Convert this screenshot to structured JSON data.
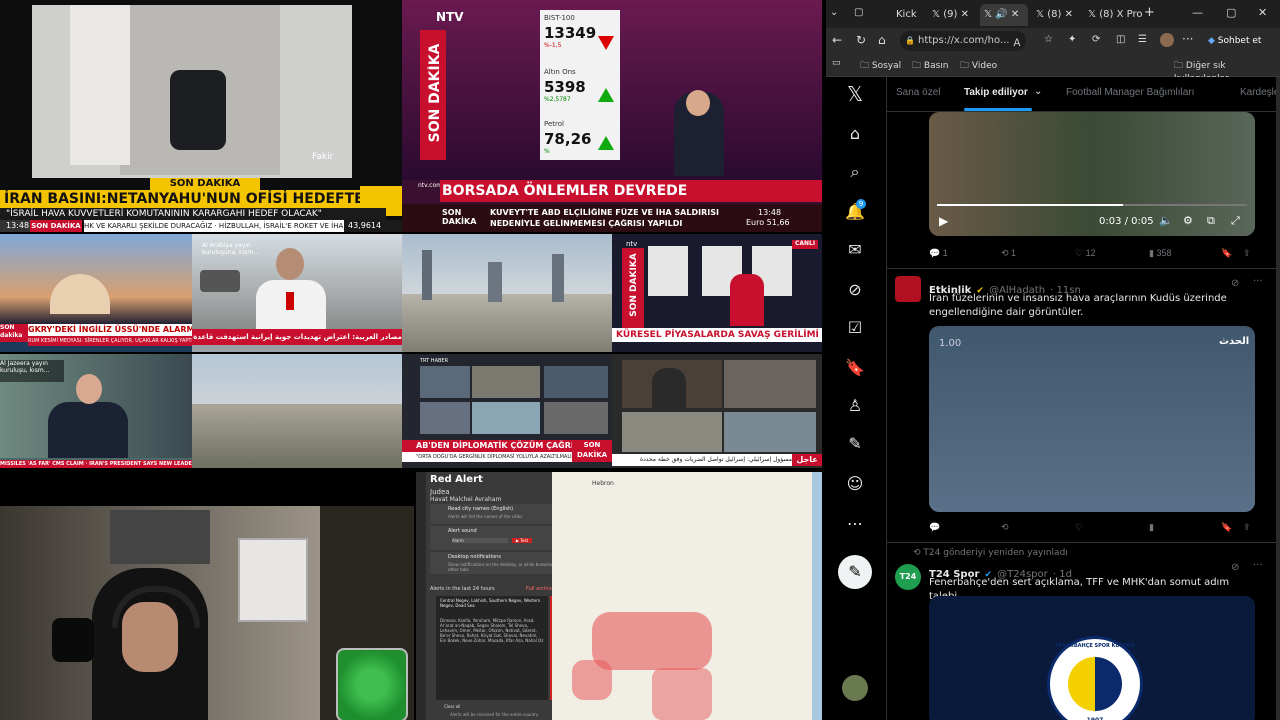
{
  "tv": {
    "top_center": {
      "logo": "NTV",
      "side_label": "SON DAKİKA",
      "board": [
        {
          "name": "BIST-100",
          "value": "13349",
          "change": "%-1,5"
        },
        {
          "name": "Altın Ons",
          "value": "5398",
          "change": "%2,5787"
        },
        {
          "name": "Petrol",
          "value": "78,26",
          "change": "%"
        }
      ],
      "headline": "BORSADA ÖNLEMLER DEVREDE",
      "sub_label": "SON DAKİKA",
      "sub_text_1": "KUVEYT'TE ABD ELÇİLİĞİNE FÜZE VE İHA SALDIRISI",
      "sub_text_2": "NEDENİYLE GELİNMEMESİ ÇAĞRISI YAPILDI",
      "time": "13:48",
      "euro": "Euro   51,66",
      "site": "ntv.com.tr"
    },
    "top_left": {
      "watermark": "Fakir",
      "tag": "SON DAKİKA",
      "headline": "İRAN BASINI:NETANYAHU'NUN OFİSİ HEDEFTE",
      "sub": "\"İSRAİL HAVA KUVVETLERİ KOMUTANININ KARARGAHI HEDEF OLACAK\"",
      "time": "13:48",
      "ticker_label": "SON DAKİKA",
      "ticker": "HK VE KARARLI ŞEKİLDE DURACAĞIZ  ·  HİZBULLAH, İSRAİL'E ROKET VE İHA",
      "value": "43,9614"
    },
    "mid_1": {
      "label": "SON dakika",
      "headline": "GKRY'DEKİ İNGİLİZ ÜSSÜ'NDE ALARM",
      "sub": "RUM KESİMİ MEDYASI: SİRENLER ÇALIYOR, UÇAKLAR KALKIŞ YAPTI"
    },
    "mid_2": {
      "caption": "Al Arabiya yayın kuruluşuna, kısm...",
      "bar": "مصادر العربية: اعتراض تهديدات جوية إيرانية استهدفت قاعدة قرب الرياض"
    },
    "mid_4": {
      "logo": "ntv",
      "tag": "SON DAKİKA",
      "headline": "KÜRESEL PİYASALARDA SAVAŞ GERİLİMİ",
      "live": "CANLI"
    },
    "row3_1": {
      "caption": "Al Jazeera yayın kuruluşu, kısm...",
      "ticker": "MISSILES 'AS FAR' CMS CLAIM  ·  IRAN'S PRESIDENT SAYS NEW LEADERSHIP COUNCIL"
    },
    "row3_3": {
      "network": "TRT HABER",
      "headline": "AB'DEN DİPLOMATİK ÇÖZÜM ÇAĞRISI",
      "sub": "\"ORTA DOĞU'DA GERGİNLİK DİPLOMASİ YOLUYLA AZALTILMALI\"",
      "tag": "SON DAKİKA"
    },
    "row3_4": {
      "urgent": "عاجل",
      "ticker": "مسؤول إسرائيلي: إسرائيل تواصل الضربات وفق خطة محددة"
    }
  },
  "redalert": {
    "title": "Red Alert",
    "region": "Judea",
    "city": "Havat Malchei Avraham",
    "opt1_title": "Read city names (English)",
    "opt1_desc": "Alerts will tell the names of the cities",
    "opt2_title": "Alert sound",
    "opt2_value": "Alarm",
    "opt2_btn": "▶ Test",
    "opt3_title": "Desktop notifications",
    "opt3_desc": "Show notifications on the desktop, or while browsing other tabs",
    "alerts_header": "Alerts in the last 24 hours",
    "full_archive": "Full archive",
    "alert_regions": "Central Negev, Lakhish, Southern Negev, Western Negev, Dead Sea",
    "alert_list": "Dimona, Kseifa, Yeruham, Mitzpe Ramon, Arad, Ar'arat an-Naqab, Segev Shalom, Tel Sheva, Lehavim, Omer, Meitar, Ofakim, Netivot, Sderot, Be'er Sheva, Rahat, Kiryat Gat, Shoval, Nevatim, Ein Bokek, Neve Zohar, Masada, Kfar Aza, Nahal Oz",
    "clear_all": "Clear all",
    "footer": "Alerts will be received for the entire country",
    "map_label": "Hebron"
  },
  "browser": {
    "tabs": [
      {
        "label": "Kick"
      },
      {
        "label": "(9)"
      },
      {
        "label": ""
      },
      {
        "label": "(8)"
      },
      {
        "label": "(8) X Pro"
      }
    ],
    "new_tab": "+",
    "url": "https://x.com/ho...",
    "chat_btn": "Sohbet et",
    "bookmarks": [
      "Sosyal",
      "Basın",
      "Video"
    ],
    "other_bookmarks": "Diğer sık kullanılanlar"
  },
  "x": {
    "tabs": [
      "Sana özel",
      "Takip ediliyor",
      "Football Manager Bağımlıları",
      "Kardeşle"
    ],
    "notif_count": "9",
    "post1": {
      "time": "0:03 / 0:05",
      "replies": "1",
      "reposts": "1",
      "likes": "12",
      "views": "358"
    },
    "post2": {
      "name": "Etkinlik",
      "handle": "@AlHadath",
      "age": "· 11sn",
      "text": "İran füzelerinin ve insansız hava araçlarının Kudüs üzerinde engellendiğine dair görüntüler.",
      "badge": "1.00",
      "watermark": "الحدث",
      "replies": "1"
    },
    "post3": {
      "repost_note": "T24 gönderiyi yeniden yayınladı",
      "name": "T24 Spor",
      "handle": "@T24spor",
      "age": "· 1d",
      "text": "Fenerbahçe'den sert açıklama, TFF ve MHK'dan somut adım talebi",
      "avatar_text": "T24",
      "crest_text": "FENERBAHÇE SPOR KULÜBÜ",
      "crest_year": "1907"
    }
  }
}
